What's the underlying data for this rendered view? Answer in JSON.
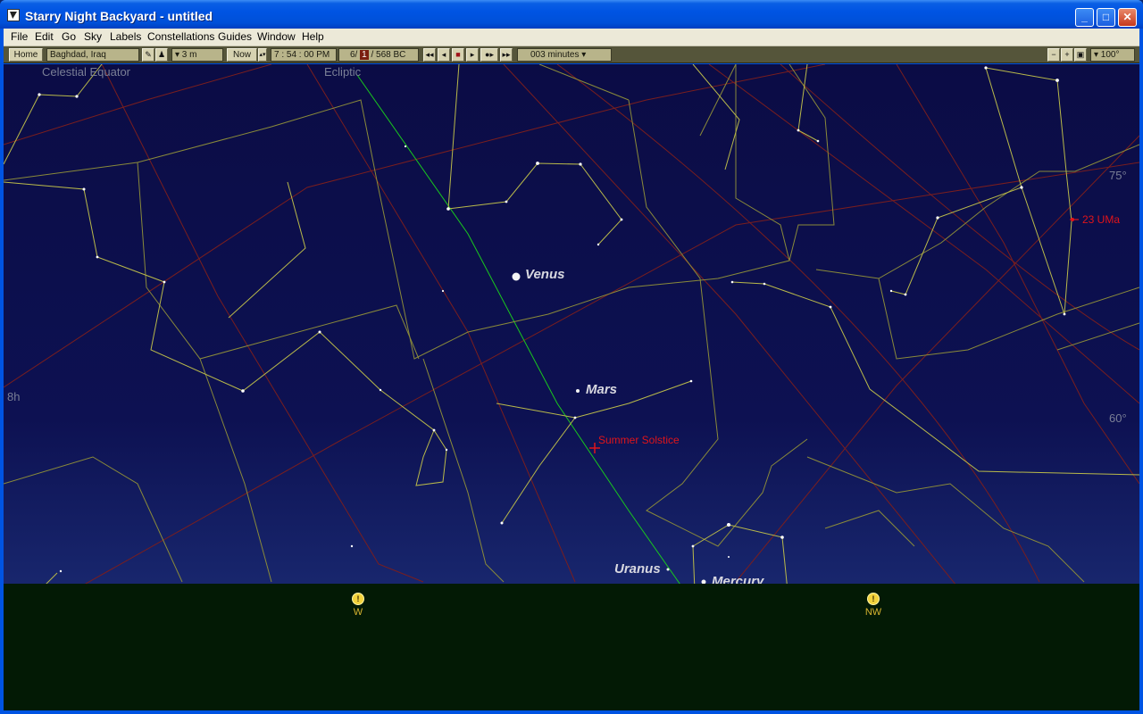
{
  "window": {
    "title": "Starry Night Backyard - untitled",
    "buttons": {
      "minimize": "_",
      "maximize": "□",
      "close": "✕"
    }
  },
  "menu": [
    "File",
    "Edit",
    "Go",
    "Sky",
    "Labels",
    "Constellations",
    "Guides",
    "Window",
    "Help"
  ],
  "toolbar": {
    "home": "Home",
    "location": "Baghdad, Iraq",
    "elevation": "▾ 3 m",
    "now": "Now",
    "time": "7 : 54 : 00 PM",
    "date_month": "6/",
    "date_day": "1",
    "date_year": "/ 568 BC",
    "time_step": "003 minutes ▾",
    "fov": "▾ 100°"
  },
  "sky": {
    "grid_labels": {
      "celestial_equator": "Celestial Equator",
      "ecliptic": "Ecliptic",
      "ra_8h": "8h",
      "alt_75": "75°",
      "alt_60": "60°"
    },
    "objects": {
      "venus": "Venus",
      "mars": "Mars",
      "uranus": "Uranus",
      "mercury": "Mercury",
      "summer_solstice": "Summer Solstice",
      "star_23uma": "23 UMa"
    },
    "compass": {
      "west": "W",
      "northwest": "NW"
    }
  },
  "colors": {
    "sky_top": "#0b0c45",
    "ground": "#031a05",
    "ecliptic_line": "#19c81e",
    "grid_line": "#7a1e1e",
    "constellation_line": "#b9b94a",
    "label_red": "#e0141a"
  }
}
